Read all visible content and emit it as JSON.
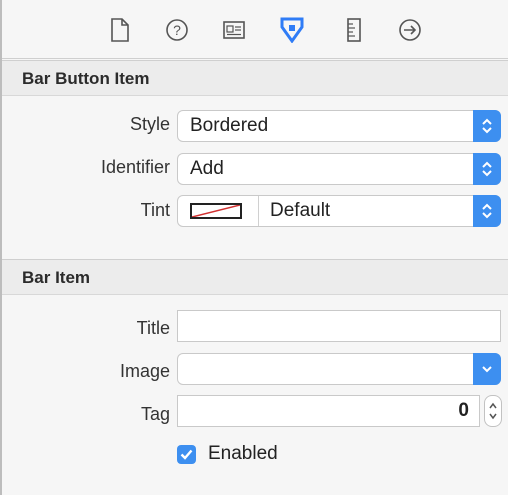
{
  "toolbar": {
    "icons": [
      "file-inspector-icon",
      "quick-help-icon",
      "identity-inspector-icon",
      "attributes-inspector-icon",
      "size-inspector-icon",
      "connections-inspector-icon"
    ],
    "accent": "#2f7cf6"
  },
  "bar_button_item": {
    "header": "Bar Button Item",
    "style_label": "Style",
    "style_value": "Bordered",
    "identifier_label": "Identifier",
    "identifier_value": "Add",
    "tint_label": "Tint",
    "tint_value": "Default"
  },
  "bar_item": {
    "header": "Bar Item",
    "title_label": "Title",
    "title_value": "",
    "image_label": "Image",
    "image_value": "",
    "tag_label": "Tag",
    "tag_value": "0",
    "enabled_label": "Enabled",
    "enabled": true
  }
}
